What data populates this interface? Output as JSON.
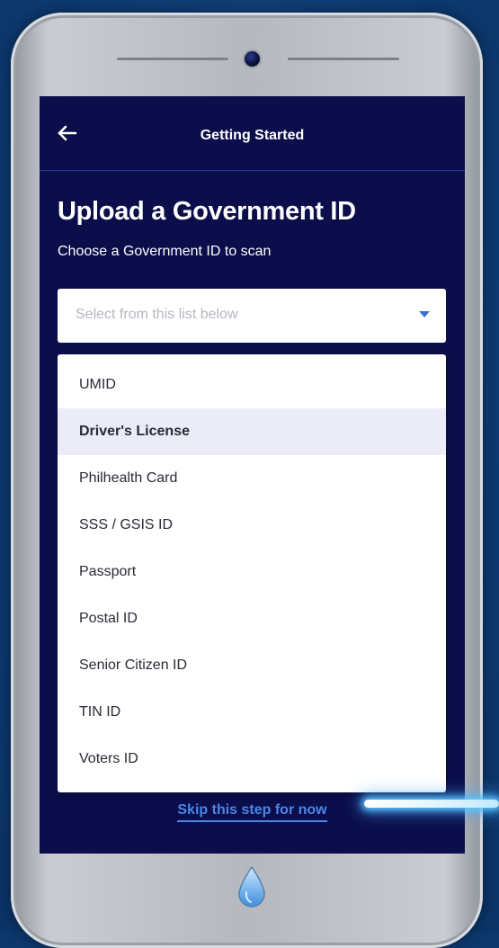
{
  "header": {
    "title": "Getting Started"
  },
  "main": {
    "heading": "Upload a Government ID",
    "subheading": "Choose a Government ID to scan"
  },
  "select": {
    "placeholder": "Select from this list below"
  },
  "dropdown": {
    "highlighted_index": 1,
    "options": [
      "UMID",
      "Driver's License",
      "Philhealth Card",
      "SSS / GSIS ID",
      "Passport",
      "Postal ID",
      "Senior Citizen ID",
      "TIN ID",
      "Voters ID"
    ]
  },
  "footer": {
    "skip_label": "Skip this step for now"
  },
  "icons": {
    "back": "arrow-left-icon",
    "caret": "caret-down-icon",
    "home": "water-drop-icon"
  },
  "colors": {
    "screen_background": "#0b0e4a",
    "accent": "#3a6fd8",
    "link": "#4a86e8",
    "highlight": "#ececf8"
  }
}
